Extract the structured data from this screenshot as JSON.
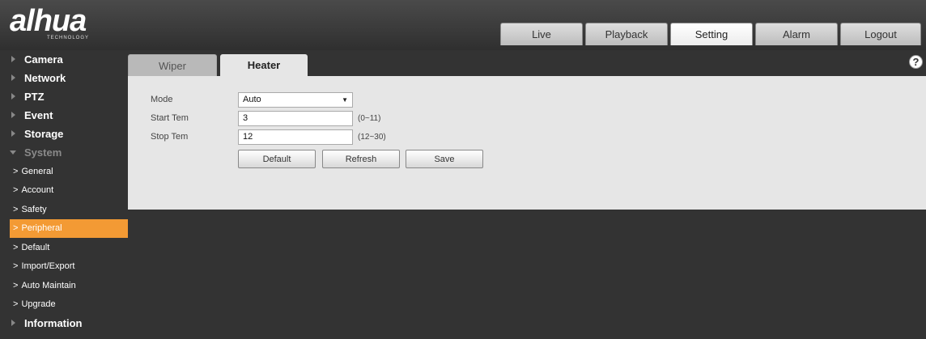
{
  "brand": {
    "logo_text": "alhua",
    "logo_sub": "TECHNOLOGY"
  },
  "topnav": [
    "Live",
    "Playback",
    "Setting",
    "Alarm",
    "Logout"
  ],
  "topnav_active": "Setting",
  "sidebar": {
    "sections_before": [
      "Camera",
      "Network",
      "PTZ",
      "Event",
      "Storage"
    ],
    "expanded": "System",
    "sub_items": [
      "General",
      "Account",
      "Safety",
      "Peripheral",
      "Default",
      "Import/Export",
      "Auto Maintain",
      "Upgrade"
    ],
    "active_sub": "Peripheral",
    "sections_after": [
      "Information"
    ]
  },
  "tabs": {
    "wiper": "Wiper",
    "heater": "Heater",
    "active": "Heater"
  },
  "help_icon": "?",
  "form": {
    "mode": {
      "label": "Mode",
      "value": "Auto"
    },
    "start": {
      "label": "Start Tem",
      "value": "3",
      "hint": "(0~11)"
    },
    "stop": {
      "label": "Stop Tem",
      "value": "12",
      "hint": "(12~30)"
    }
  },
  "buttons": {
    "default": "Default",
    "refresh": "Refresh",
    "save": "Save"
  },
  "colors": {
    "accent": "#f39a34",
    "background": "#333333",
    "panel": "#e6e6e6"
  }
}
